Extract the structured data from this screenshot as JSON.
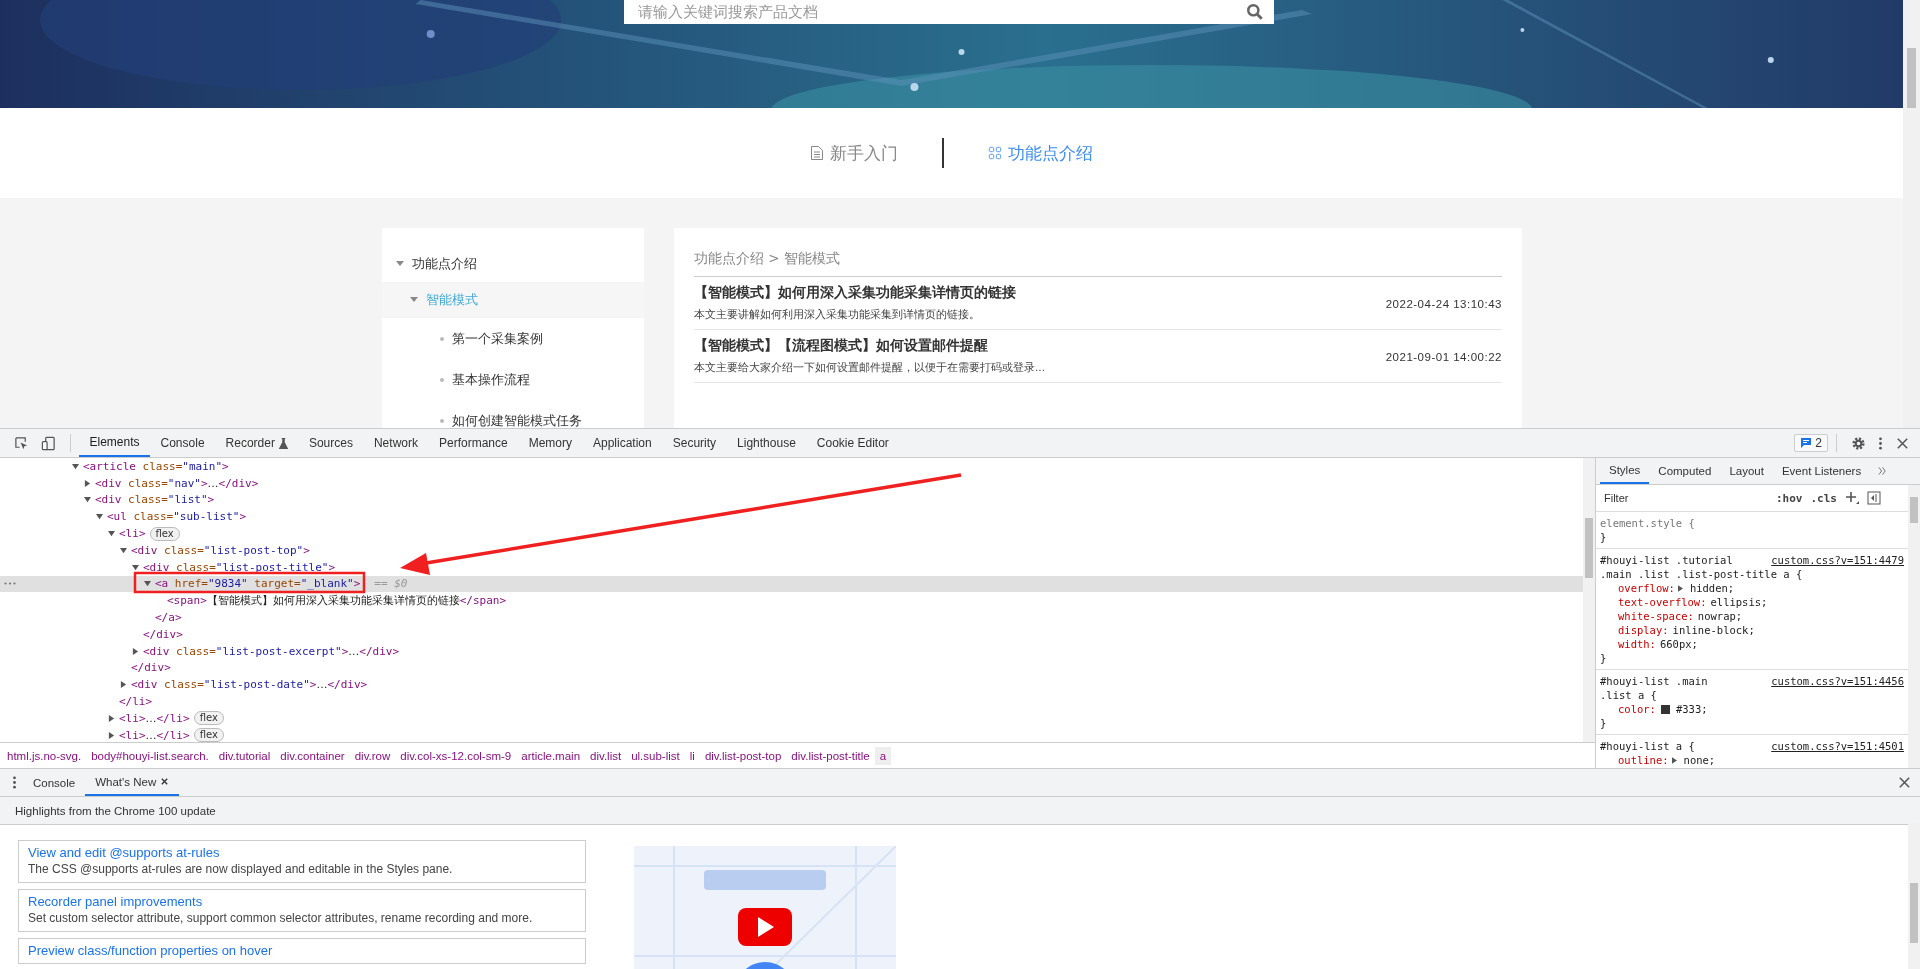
{
  "page": {
    "search": {
      "placeholder": "请输入关键词搜索产品文档"
    },
    "nav_tabs": [
      {
        "label": "新手入门",
        "selected": false
      },
      {
        "label": "功能点介绍",
        "selected": true
      }
    ],
    "sidebar": [
      {
        "label": "功能点介绍",
        "expanded": true,
        "selected": false,
        "children": [
          {
            "label": "智能模式",
            "expanded": true,
            "selected": true,
            "children": [
              {
                "label": "第一个采集案例",
                "selected": false
              },
              {
                "label": "基本操作流程",
                "selected": false
              },
              {
                "label": "如何创建智能模式任务",
                "selected": false
              }
            ]
          }
        ]
      }
    ],
    "breadcrumb": "功能点介绍 > 智能模式",
    "articles": [
      {
        "title": "【智能模式】如何用深入采集功能采集详情页的链接",
        "date": "2022-04-24 13:10:43",
        "excerpt": "本文主要讲解如何利用深入采集功能采集到详情页的链接。"
      },
      {
        "title": "【智能模式】【流程图模式】如何设置邮件提醒",
        "date": "2021-09-01 14:00:22",
        "excerpt": "本文主要给大家介绍一下如何设置邮件提醒，以便于在需要打码或登录..."
      }
    ]
  },
  "devtools": {
    "tabs": [
      {
        "label": "Elements",
        "selected": true,
        "experimental": false
      },
      {
        "label": "Console",
        "selected": false,
        "experimental": false
      },
      {
        "label": "Recorder",
        "selected": false,
        "experimental": true
      },
      {
        "label": "Sources",
        "selected": false,
        "experimental": false
      },
      {
        "label": "Network",
        "selected": false,
        "experimental": false
      },
      {
        "label": "Performance",
        "selected": false,
        "experimental": false
      },
      {
        "label": "Memory",
        "selected": false,
        "experimental": false
      },
      {
        "label": "Application",
        "selected": false,
        "experimental": false
      },
      {
        "label": "Security",
        "selected": false,
        "experimental": false
      },
      {
        "label": "Lighthouse",
        "selected": false,
        "experimental": false
      },
      {
        "label": "Cookie Editor",
        "selected": false,
        "experimental": false
      }
    ],
    "issues_count": "2",
    "dom_tree": [
      {
        "text": "<article class=\"main\">",
        "expanded": true,
        "selected": false,
        "children": [
          {
            "text": "<div class=\"nav\">…</div>",
            "expanded": false,
            "selected": false
          },
          {
            "text": "<div class=\"list\">",
            "expanded": true,
            "selected": false,
            "children": [
              {
                "text": "<ul class=\"sub-list\">",
                "expanded": true,
                "selected": false,
                "children": [
                  {
                    "text": "<li>",
                    "badge": "flex",
                    "expanded": true,
                    "selected": false,
                    "close": "</li>",
                    "children": [
                      {
                        "text": "<div class=\"list-post-top\">",
                        "expanded": true,
                        "selected": false,
                        "close": "</div>",
                        "children": [
                          {
                            "text": "<div class=\"list-post-title\">",
                            "expanded": true,
                            "selected": false,
                            "close": "</div>",
                            "children": [
                              {
                                "text": "<a href=\"9834\" target=\"_blank\">",
                                "suffix": "== $0",
                                "expanded": true,
                                "selected": true,
                                "close": "</a>",
                                "children": [
                                  {
                                    "text": "<span>【智能模式】如何用深入采集功能采集详情页的链接</span>",
                                    "selected": false
                                  }
                                ]
                              }
                            ]
                          },
                          {
                            "text": "<div class=\"list-post-excerpt\">…</div>",
                            "expanded": false,
                            "selected": false
                          }
                        ]
                      },
                      {
                        "text": "<div class=\"list-post-date\">…</div>",
                        "expanded": false,
                        "selected": false
                      }
                    ]
                  },
                  {
                    "text": "<li>…</li>",
                    "badge": "flex",
                    "expanded": false,
                    "selected": false
                  },
                  {
                    "text": "<li>…</li>",
                    "badge": "flex",
                    "expanded": false,
                    "selected": false
                  }
                ]
              }
            ]
          }
        ]
      }
    ],
    "breadcrumbs": [
      {
        "label": "html.js.no-svg.",
        "selected": false
      },
      {
        "label": "body#houyi-list.search.",
        "selected": false
      },
      {
        "label": "div.tutorial",
        "selected": false
      },
      {
        "label": "div.container",
        "selected": false
      },
      {
        "label": "div.row",
        "selected": false
      },
      {
        "label": "div.col-xs-12.col-sm-9",
        "selected": false
      },
      {
        "label": "article.main",
        "selected": false
      },
      {
        "label": "div.list",
        "selected": false
      },
      {
        "label": "ul.sub-list",
        "selected": false
      },
      {
        "label": "li",
        "selected": false
      },
      {
        "label": "div.list-post-top",
        "selected": false
      },
      {
        "label": "div.list-post-title",
        "selected": false
      },
      {
        "label": "a",
        "selected": true
      }
    ],
    "styles": {
      "tabs": [
        {
          "label": "Styles",
          "selected": true
        },
        {
          "label": "Computed",
          "selected": false
        },
        {
          "label": "Layout",
          "selected": false
        },
        {
          "label": "Event Listeners",
          "selected": false
        }
      ],
      "filter": {
        "placeholder": "Filter"
      },
      "toggles": [
        ":hov",
        ".cls"
      ],
      "rules": [
        {
          "selector": [
            "element.style {"
          ],
          "end": "}"
        },
        {
          "selector": [
            "#houyi-list .tutorial",
            ".main .list .list-post-title a {"
          ],
          "source": "custom.css?v=151:4479",
          "end": "}",
          "declarations": [
            {
              "name": "overflow:",
              "value": "hidden;",
              "expandable": true
            },
            {
              "name": "text-overflow:",
              "value": "ellipsis;",
              "expandable": false
            },
            {
              "name": "white-space:",
              "value": "nowrap;",
              "expandable": false
            },
            {
              "name": "display:",
              "value": "inline-block;",
              "expandable": false
            },
            {
              "name": "width:",
              "value": "660px;",
              "expandable": false
            }
          ]
        },
        {
          "selector": [
            "#houyi-list .main",
            ".list a {"
          ],
          "source": "custom.css?v=151:4456",
          "end": "}",
          "declarations": [
            {
              "name": "color:",
              "value": "#333;",
              "expandable": false,
              "color": "#333333"
            }
          ]
        },
        {
          "selector": [
            "#houyi-list a {"
          ],
          "source": "custom.css?v=151:4501",
          "declarations": [
            {
              "name": "outline:",
              "value": "none;",
              "expandable": true
            }
          ]
        }
      ]
    }
  },
  "drawer": {
    "tabs": [
      {
        "label": "Console",
        "selected": false,
        "closable": false
      },
      {
        "label": "What's New",
        "selected": true,
        "closable": true
      }
    ],
    "headline": "Highlights from the Chrome 100 update",
    "features": [
      {
        "title": "View and edit @supports at-rules",
        "description": "The CSS @supports at-rules are now displayed and editable in the Styles pane."
      },
      {
        "title": "Recorder panel improvements",
        "description": "Set custom selector attribute, support common selector attributes, rename recording and more."
      },
      {
        "title": "Preview class/function properties on hover"
      }
    ]
  }
}
